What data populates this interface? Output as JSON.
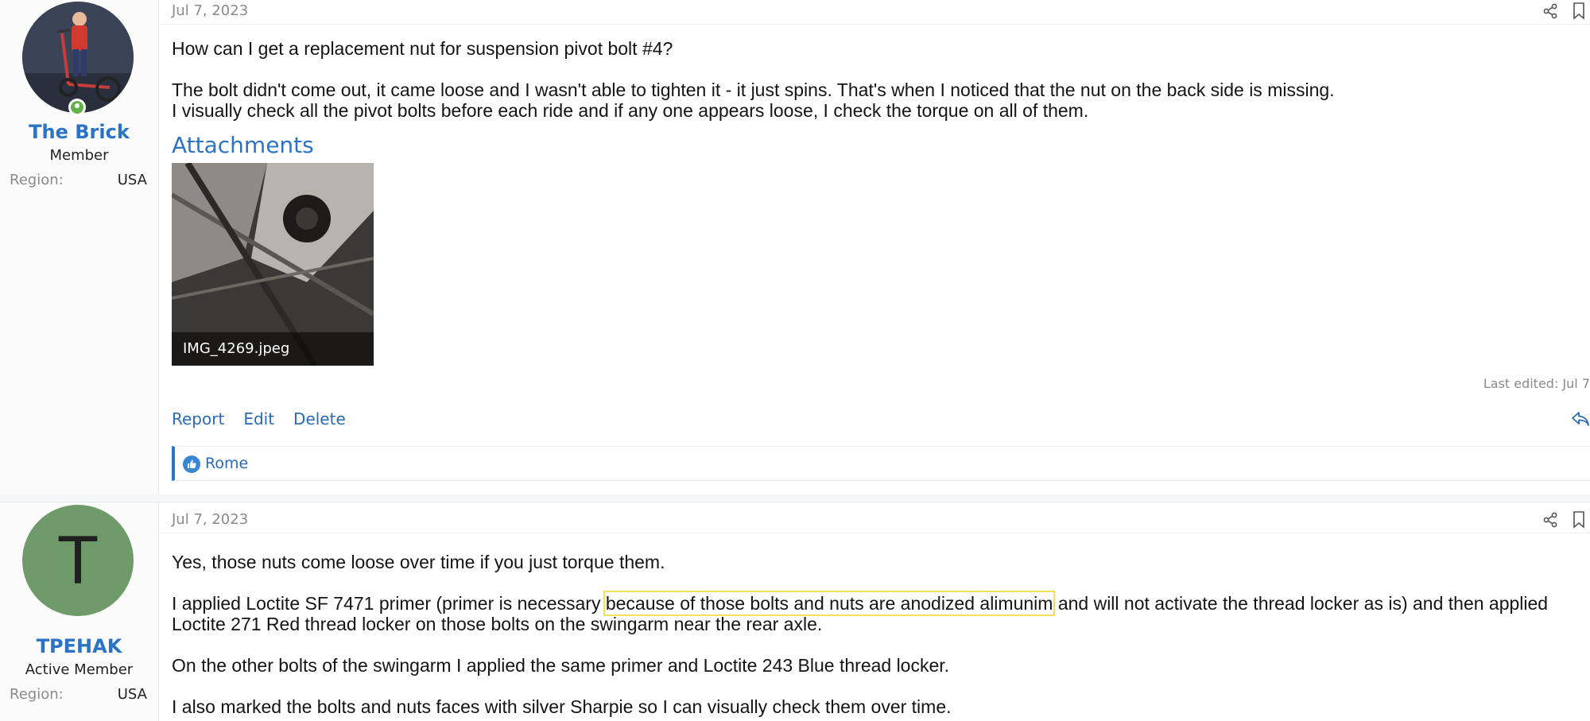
{
  "post1": {
    "user": {
      "name": "The Brick",
      "title": "Member",
      "region_label": "Region:",
      "region_value": "USA",
      "online": true
    },
    "date": "Jul 7, 2023",
    "paragraphs": [
      "How can I get a replacement nut for suspension pivot bolt #4?",
      "The bolt didn't come out, it came loose and I wasn't able to tighten it - it just spins. That's when I noticed that the nut on the back side is missing.",
      "I visually check all the pivot bolts before each ride and if any one appears loose, I check the torque on all of them."
    ],
    "attachments_title": "Attachments",
    "attachment_filename": "IMG_4269.jpeg",
    "last_edited": "Last edited: Jul 7",
    "actions": [
      "Report",
      "Edit",
      "Delete"
    ],
    "reaction_user": "Rome"
  },
  "post2": {
    "user": {
      "name": "TPEHAK",
      "title": "Active Member",
      "region_label": "Region:",
      "region_value": "USA",
      "avatar_letter": "T"
    },
    "date": "Jul 7, 2023",
    "p1": "Yes, those nuts come loose over time if you just torque them.",
    "p2_before": "I applied Loctite SF 7471 primer (primer is necessary ",
    "p2_highlight": "because of those bolts and nuts are anodized alimunim",
    "p2_after": " and will not activate the thread locker as is) and then applied Loctite 271 Red thread locker on those bolts on the swingarm near the rear axle.",
    "p3": "On the other bolts of the swingarm I applied the same primer and Loctite 243 Blue thread locker.",
    "p4": "I also marked the bolts and nuts faces with silver Sharpie so I can visually check them over time."
  },
  "colors": {
    "accent": "#2b73c4",
    "link": "#2b6bb6",
    "highlight": "#f1e05a",
    "online": "#63b34b",
    "avatar_green": "#6f9a6a"
  },
  "icons": [
    "share-icon",
    "bookmark-icon",
    "reply-icon",
    "like-icon",
    "online-status-icon"
  ]
}
